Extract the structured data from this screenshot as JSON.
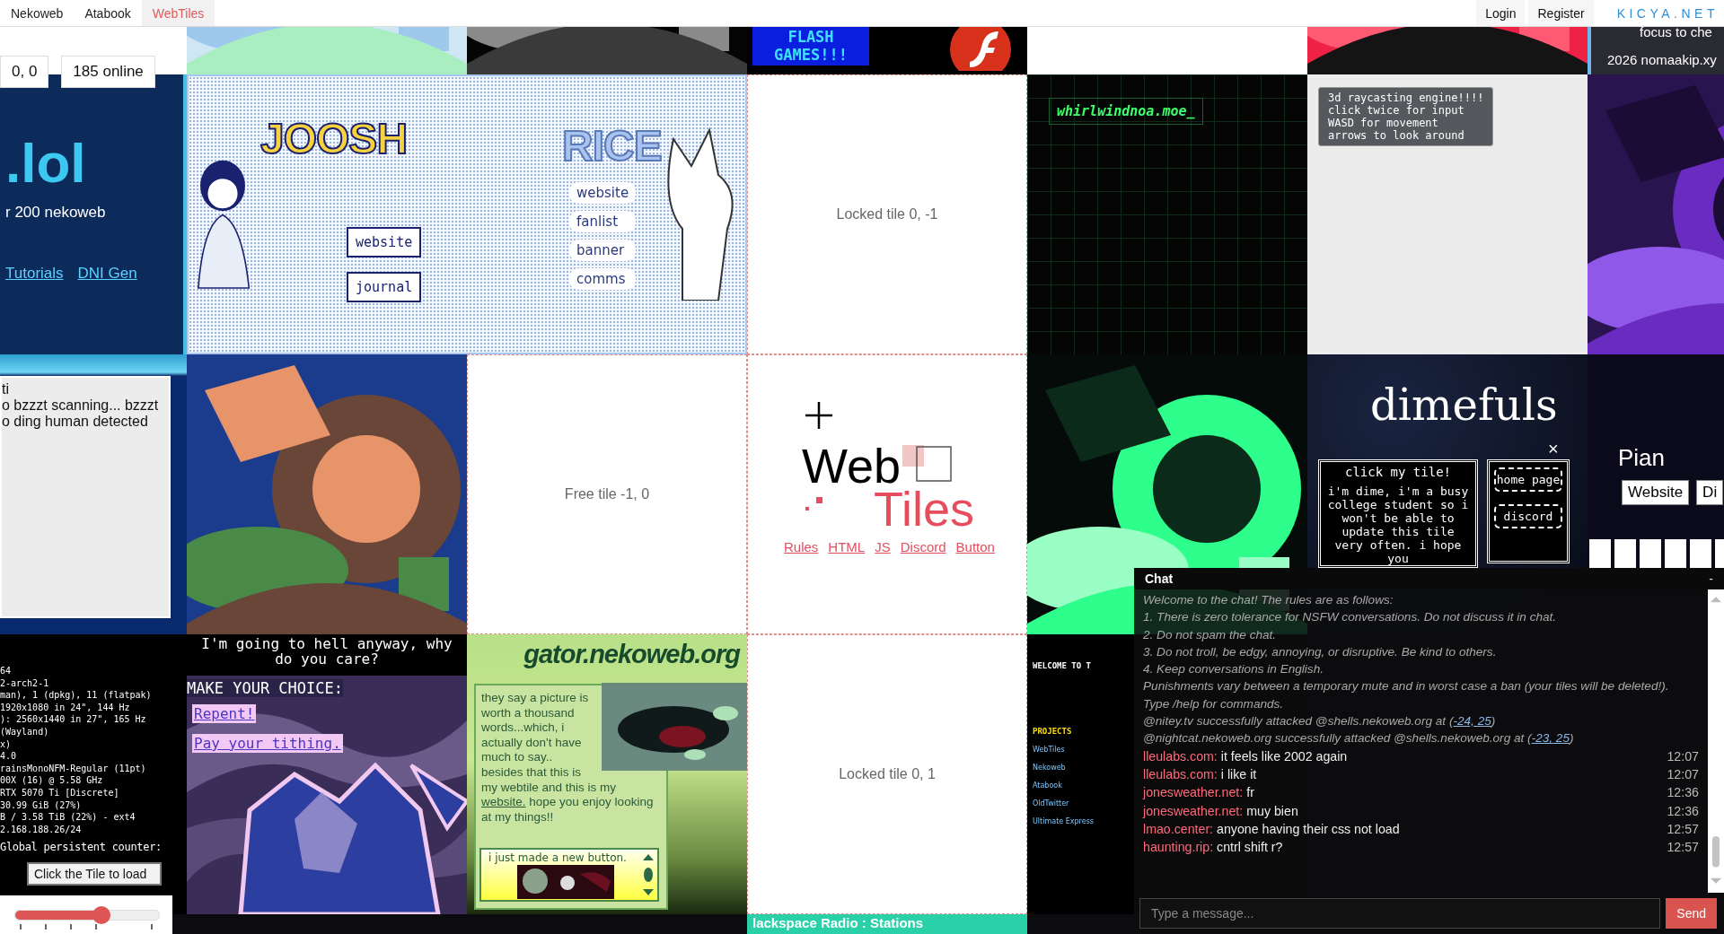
{
  "nav": {
    "links": [
      {
        "label": "Nekoweb",
        "selected": false
      },
      {
        "label": "Atabook",
        "selected": false
      },
      {
        "label": "WebTiles",
        "selected": true
      }
    ],
    "account": [
      "Login",
      "Register"
    ],
    "brand": "KICYA.NET"
  },
  "hud": {
    "coords": "0, 0",
    "online": "185 online"
  },
  "tiles": [
    {
      "kind": "empty"
    },
    {
      "kind": "picture"
    },
    {
      "kind": "picture"
    },
    {
      "kind": "flash",
      "title": "FLASH GAMES!!!"
    },
    {
      "kind": "empty"
    },
    {
      "kind": "picture"
    },
    {
      "kind": "nomaakip",
      "lines": [
        "focus to che",
        "2026 nomaakip.xy"
      ]
    },
    {
      "kind": "lol",
      "title": ".lol",
      "subtitle": "r 200 nekoweb",
      "links": [
        "Tutorials",
        "DNI Gen"
      ]
    },
    {
      "kind": "joosh_rice",
      "left": {
        "title": "JOOSH",
        "buttons": [
          "website",
          "journal"
        ]
      },
      "right": {
        "title": "RICE",
        "links": [
          "website",
          "fanlist",
          "banner",
          "comms"
        ]
      }
    },
    {
      "kind": "status",
      "text": "Locked tile 0, -1"
    },
    {
      "kind": "whirlwind",
      "label": "whirlwindnoa.moe_"
    },
    {
      "kind": "raycast",
      "lines": [
        "3d raycasting engine!!!!",
        "click twice for input",
        "WASD for movement",
        "arrows to look around"
      ]
    },
    {
      "kind": "picture"
    },
    {
      "kind": "bzzzt",
      "lines": [
        "ti",
        "o bzzzt scanning... bzzzt",
        "o ding human detected"
      ]
    },
    {
      "kind": "picture"
    },
    {
      "kind": "status",
      "text": "Free tile -1, 0"
    },
    {
      "kind": "webtiles",
      "word1": "Web",
      "word2": "Tiles",
      "links": [
        "Rules",
        "HTML",
        "JS",
        "Discord",
        "Button"
      ]
    },
    {
      "kind": "picture"
    },
    {
      "kind": "dimefuls",
      "title": "dimefuls",
      "close": "×",
      "card_title": "click my tile!",
      "card_text": "i'm dime, i'm a busy college student so i won't be able to update this tile very often. i hope you",
      "buttons": [
        "home page",
        "discord"
      ]
    },
    {
      "kind": "piano",
      "title": "Pian",
      "buttons": [
        "Website",
        "Di"
      ]
    },
    {
      "kind": "fastfetch",
      "lines": [
        "64",
        "2-arch2-1",
        "man), 1 (dpkg), 11 (flatpak)",
        "1920x1080 in 24\", 144 Hz",
        "): 2560x1440 in 27\", 165 Hz",
        "(Wayland)",
        "x)",
        "4.0",
        "rainsMonoNFM-Regular (11pt)",
        "00X (16) @ 5.58 GHz",
        "RTX 5070 Ti [Discrete]",
        "30.99 GiB (27%)",
        "B / 3.58 TiB (22%) - ext4",
        "2.168.188.26/24"
      ],
      "counter": "Global persistent counter:",
      "button": "Click the Tile to load"
    },
    {
      "kind": "choice",
      "caption": "I'm going to hell anyway, why do you care?",
      "prompt": "MAKE YOUR CHOICE:",
      "options": [
        "Repent!",
        "Pay your tithing."
      ]
    },
    {
      "kind": "gator",
      "title": "gator.nekoweb.org",
      "text": "they say a picture is worth a thousand words...which, i actually don't have much to say.. besides that this is my webtile and this is my",
      "link": "website.",
      "after": "hope you enjoy looking at my things!!",
      "note": "i just made a new button."
    },
    {
      "kind": "status",
      "text": "Locked tile 0, 1"
    },
    {
      "kind": "welcome",
      "heading": "WELCOME TO T",
      "section": "PROJECTS",
      "items": [
        "WebTiles",
        "Nekoweb",
        "Atabook",
        "OldTwitter",
        "Ultimate Express"
      ]
    },
    {
      "kind": "void"
    },
    {
      "kind": "void"
    },
    {
      "kind": "void"
    },
    {
      "kind": "void"
    },
    {
      "kind": "void"
    },
    {
      "kind": "radio",
      "text": "lackspace Radio : Stations"
    },
    {
      "kind": "void"
    },
    {
      "kind": "void"
    },
    {
      "kind": "void"
    }
  ],
  "volume": {
    "level": 0.6
  },
  "chat": {
    "title": "Chat",
    "minimize": "-",
    "messages": [
      {
        "kind": "system",
        "text": "Welcome to the chat! The rules are as follows:"
      },
      {
        "kind": "system",
        "text": "1. There is zero tolerance for NSFW conversations. Do not discuss it in chat."
      },
      {
        "kind": "system",
        "text": "2. Do not spam the chat."
      },
      {
        "kind": "system",
        "text": "3. Do not troll, be edgy, annoying, or disruptive. Be kind to others."
      },
      {
        "kind": "system",
        "text": "4. Keep conversations in English."
      },
      {
        "kind": "system",
        "text": "Punishments vary between a temporary mute and in worst case a ban (your tiles will be deleted!)."
      },
      {
        "kind": "system",
        "text": "Type /help for commands."
      },
      {
        "kind": "system",
        "text": "@nitey.tv successfully attacked @shells.nekoweb.org at (",
        "link": "-24, 25",
        "after": ")"
      },
      {
        "kind": "system",
        "text": "@nightcat.nekoweb.org successfully attacked @shells.nekoweb.org at (",
        "link": "-23, 25",
        "after": ")"
      },
      {
        "kind": "user",
        "user": "lleulabs.com:",
        "text": "it feels like 2002 again",
        "time": "12:07"
      },
      {
        "kind": "user",
        "user": "lleulabs.com:",
        "text": "i like it",
        "time": "12:07"
      },
      {
        "kind": "user",
        "user": "jonesweather.net:",
        "text": "fr",
        "time": "12:36"
      },
      {
        "kind": "user",
        "user": "jonesweather.net:",
        "text": "muy bien",
        "time": "12:36"
      },
      {
        "kind": "user",
        "user": "lmao.center:",
        "text": "anyone having their css not load",
        "time": "12:57"
      },
      {
        "kind": "user",
        "user": "haunting.rip:",
        "text": "cntrl shift r?",
        "time": "12:57"
      }
    ],
    "input": {
      "placeholder": "Type a message..."
    },
    "send": "Send"
  }
}
